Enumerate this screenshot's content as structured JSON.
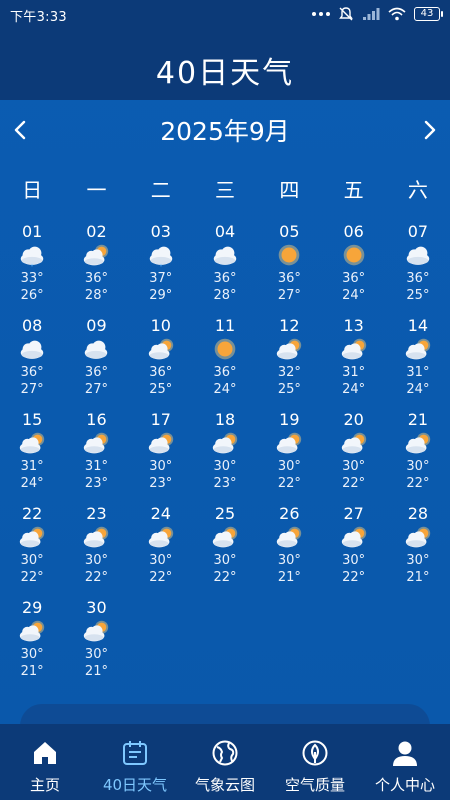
{
  "status": {
    "time": "下午3:33",
    "battery": "43"
  },
  "header": {
    "title": "40日天气"
  },
  "month": {
    "label": "2025年9月"
  },
  "weekdays": [
    "日",
    "一",
    "二",
    "三",
    "四",
    "五",
    "六"
  ],
  "days": [
    {
      "day": "01",
      "icon": "rain-cloud",
      "high": "33°",
      "low": "26°"
    },
    {
      "day": "02",
      "icon": "partly-sunny",
      "high": "36°",
      "low": "28°"
    },
    {
      "day": "03",
      "icon": "rain-cloud",
      "high": "37°",
      "low": "29°"
    },
    {
      "day": "04",
      "icon": "cloud",
      "high": "36°",
      "low": "28°"
    },
    {
      "day": "05",
      "icon": "sun",
      "high": "36°",
      "low": "27°"
    },
    {
      "day": "06",
      "icon": "sun",
      "high": "36°",
      "low": "24°"
    },
    {
      "day": "07",
      "icon": "cloud",
      "high": "36°",
      "low": "25°"
    },
    {
      "day": "08",
      "icon": "cloud",
      "high": "36°",
      "low": "27°"
    },
    {
      "day": "09",
      "icon": "cloud",
      "high": "36°",
      "low": "27°"
    },
    {
      "day": "10",
      "icon": "partly-sunny",
      "high": "36°",
      "low": "25°"
    },
    {
      "day": "11",
      "icon": "sun",
      "high": "36°",
      "low": "24°"
    },
    {
      "day": "12",
      "icon": "partly-sunny",
      "high": "32°",
      "low": "25°"
    },
    {
      "day": "13",
      "icon": "partly-sunny",
      "high": "31°",
      "low": "24°"
    },
    {
      "day": "14",
      "icon": "partly-sunny",
      "high": "31°",
      "low": "24°"
    },
    {
      "day": "15",
      "icon": "partly-sunny",
      "high": "31°",
      "low": "24°"
    },
    {
      "day": "16",
      "icon": "partly-sunny",
      "high": "31°",
      "low": "23°"
    },
    {
      "day": "17",
      "icon": "partly-sunny",
      "high": "30°",
      "low": "23°"
    },
    {
      "day": "18",
      "icon": "partly-sunny",
      "high": "30°",
      "low": "23°"
    },
    {
      "day": "19",
      "icon": "partly-sunny",
      "high": "30°",
      "low": "22°"
    },
    {
      "day": "20",
      "icon": "partly-sunny",
      "high": "30°",
      "low": "22°"
    },
    {
      "day": "21",
      "icon": "partly-sunny",
      "high": "30°",
      "low": "22°"
    },
    {
      "day": "22",
      "icon": "partly-sunny",
      "high": "30°",
      "low": "22°"
    },
    {
      "day": "23",
      "icon": "partly-sunny",
      "high": "30°",
      "low": "22°"
    },
    {
      "day": "24",
      "icon": "partly-sunny",
      "high": "30°",
      "low": "22°"
    },
    {
      "day": "25",
      "icon": "partly-sunny",
      "high": "30°",
      "low": "22°"
    },
    {
      "day": "26",
      "icon": "partly-sunny",
      "high": "30°",
      "low": "21°"
    },
    {
      "day": "27",
      "icon": "partly-sunny",
      "high": "30°",
      "low": "22°"
    },
    {
      "day": "28",
      "icon": "partly-sunny",
      "high": "30°",
      "low": "21°"
    },
    {
      "day": "29",
      "icon": "partly-sunny",
      "high": "30°",
      "low": "21°"
    },
    {
      "day": "30",
      "icon": "partly-sunny",
      "high": "30°",
      "low": "21°"
    }
  ],
  "nav": [
    {
      "label": "主页",
      "icon": "home-icon",
      "active": false
    },
    {
      "label": "40日天气",
      "icon": "calendar-icon",
      "active": true
    },
    {
      "label": "气象云图",
      "icon": "globe-icon",
      "active": false
    },
    {
      "label": "空气质量",
      "icon": "leaf-icon",
      "active": false
    },
    {
      "label": "个人中心",
      "icon": "person-icon",
      "active": false
    }
  ],
  "colors": {
    "active_tab": "#7fc8ff",
    "header_bg": "#0c3a78",
    "content_bg": "#0b5cb2"
  }
}
